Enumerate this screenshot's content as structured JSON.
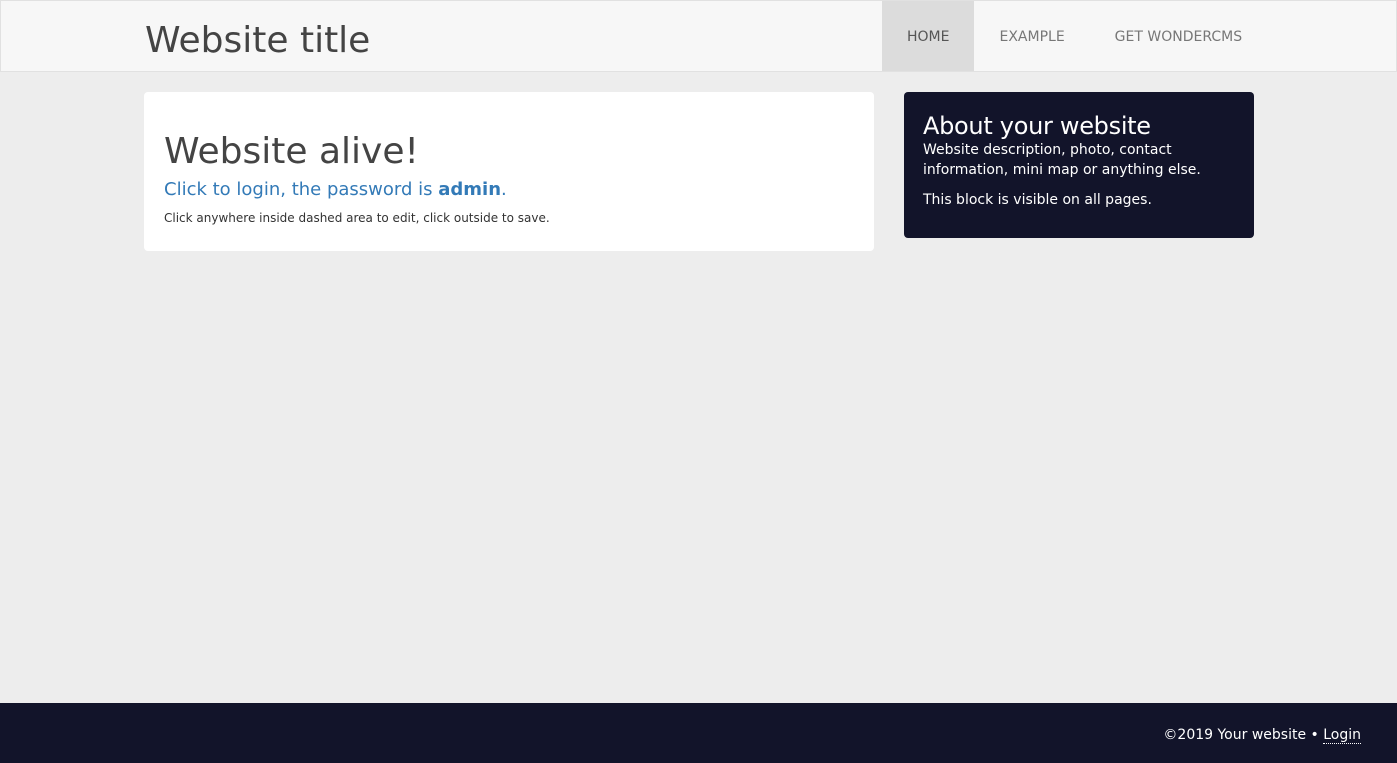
{
  "header": {
    "site_title": "Website title",
    "nav": [
      {
        "label": "HOME",
        "active": true
      },
      {
        "label": "EXAMPLE",
        "active": false
      },
      {
        "label": "GET WONDERCMS",
        "active": false
      }
    ]
  },
  "main": {
    "heading": "Website alive!",
    "login_prefix": "Click to login, the password is ",
    "password": "admin",
    "login_suffix": ".",
    "edit_hint": "Click anywhere inside dashed area to edit, click outside to save."
  },
  "sidebar": {
    "heading": "About your website",
    "description": "Website description, photo, contact information, mini map or anything else.",
    "note": "This block is visible on all pages."
  },
  "footer": {
    "copyright": "©2019 Your website • ",
    "login_label": "Login"
  },
  "colors": {
    "background": "#ededed",
    "navbar": "#f7f7f7",
    "active_nav": "#dcdcdc",
    "dark_block": "#12142a",
    "link": "#337ab7"
  }
}
